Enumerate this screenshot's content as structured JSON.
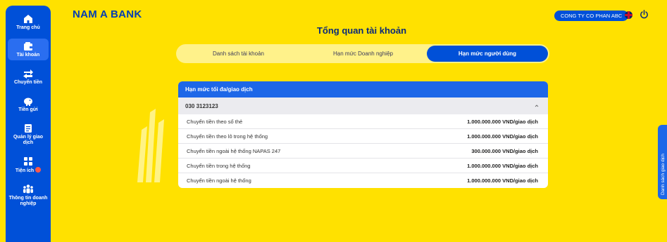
{
  "sidebar": {
    "items": [
      {
        "label": "Trang chủ",
        "icon": "home-icon"
      },
      {
        "label": "Tài khoản",
        "icon": "wallet-icon",
        "active": true
      },
      {
        "label": "Chuyển tiền",
        "icon": "transfer-icon"
      },
      {
        "label": "Tiền gửi",
        "icon": "piggy-bank-icon"
      },
      {
        "label": "Quản lý giao dịch",
        "icon": "document-icon"
      },
      {
        "label": "Tiện ích",
        "icon": "grid-icon",
        "badge": true
      },
      {
        "label": "Thông tin doanh nghiệp",
        "icon": "people-icon"
      }
    ]
  },
  "header": {
    "logo": "NAM A BANK",
    "company": "CONG TY CO PHAN ABC",
    "language_icon": "uk-flag-icon",
    "power_icon": "power-icon"
  },
  "page": {
    "title": "Tổng quan tài khoản"
  },
  "tabs": [
    {
      "label": "Danh sách tài khoản"
    },
    {
      "label": "Hạn mức Doanh nghiệp"
    },
    {
      "label": "Hạn mức người dùng",
      "active": true
    }
  ],
  "limits": {
    "header": "Hạn mức tối đa/giao dịch",
    "account": "030 3123123",
    "rows": [
      {
        "name": "Chuyển tiền theo số thẻ",
        "value": "1.000.000.000 VND/giao dịch"
      },
      {
        "name": "Chuyển tiền theo lô trong hệ thống",
        "value": "1.000.000.000 VND/giao dịch"
      },
      {
        "name": "Chuyển tiền ngoài hệ thống NAPAS 247",
        "value": "300.000.000 VND/giao dịch"
      },
      {
        "name": "Chuyển tiền trong hệ thống",
        "value": "1.000.000.000 VND/giao dịch"
      },
      {
        "name": "Chuyển tiền ngoài hệ thống",
        "value": "1.000.000.000 VND/giao dịch"
      }
    ]
  },
  "side_tab": {
    "label": "Danh sách giao dịch"
  },
  "colors": {
    "background": "#ffe100",
    "primary": "#0050d8",
    "card_header": "#1d67e8"
  }
}
